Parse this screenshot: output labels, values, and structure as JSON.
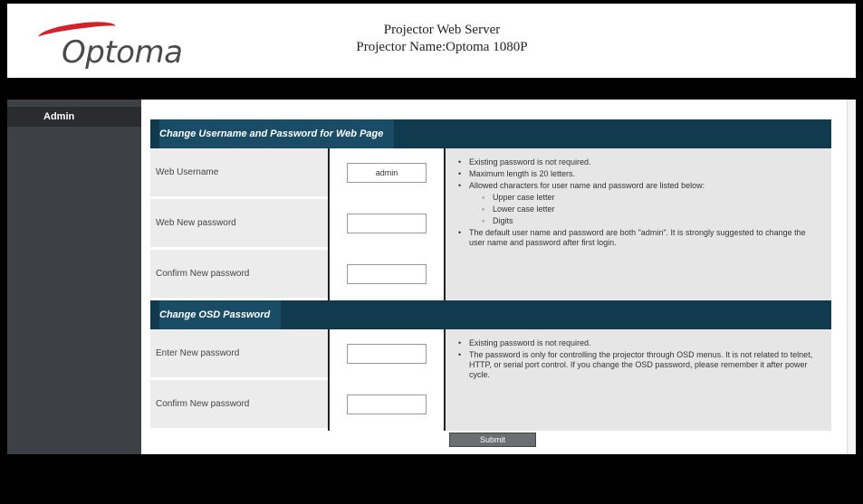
{
  "header": {
    "logo_text": "Optoma",
    "title_line1": "Projector Web Server",
    "title_line2": "Projector Name:Optoma 1080P"
  },
  "sidebar": {
    "items": [
      {
        "label": "Admin"
      }
    ]
  },
  "section1": {
    "heading": "Change Username and Password for Web Page",
    "rows": [
      {
        "label": "Web Username",
        "value": "admin"
      },
      {
        "label": "Web New password",
        "value": ""
      },
      {
        "label": "Confirm New password",
        "value": ""
      }
    ],
    "info": {
      "bullets": [
        "Existing password is not required.",
        "Maximum length is 20 letters.",
        "Allowed characters for user name and password are listed below:"
      ],
      "sub_bullets": [
        "Upper case letter",
        "Lower case letter",
        "Digits"
      ],
      "note": "The default user name and password are both \"admin\". It is strongly suggested to change the user name and password after first login."
    }
  },
  "section2": {
    "heading": "Change OSD Password",
    "rows": [
      {
        "label": "Enter New password",
        "value": ""
      },
      {
        "label": "Confirm New password",
        "value": ""
      }
    ],
    "info": {
      "bullets": [
        "Existing password is not required.",
        "The password is only for controlling the projector through OSD menus. It is not related to telnet, HTTP, or serial port control. If you change the OSD password, please remember it after power cycle."
      ]
    }
  },
  "submit_label": "Submit",
  "colors": {
    "section_header": "#123a4e",
    "sidebar": "#3d4044",
    "logo_red": "#d2232a"
  }
}
